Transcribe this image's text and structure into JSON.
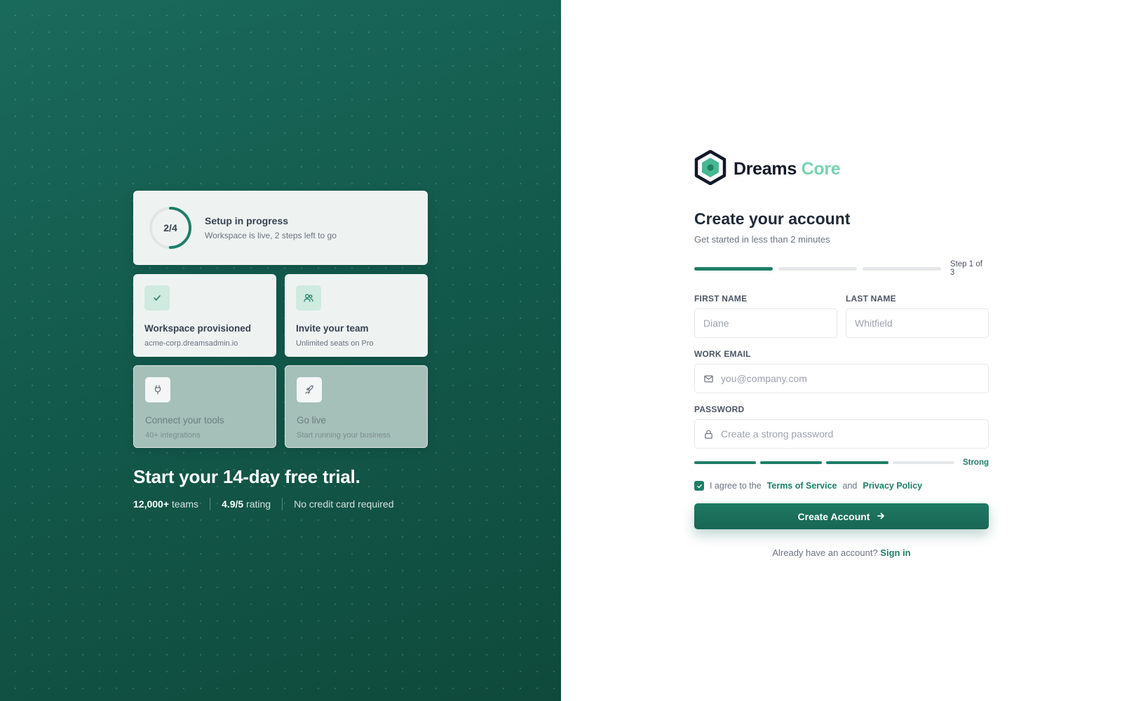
{
  "left": {
    "progress": {
      "fraction": "2/4",
      "value": 0.5,
      "title": "Setup in progress",
      "subtitle": "Workspace is live, 2 steps left to go"
    },
    "steps": [
      {
        "title": "Workspace provisioned",
        "subtitle": "acme-corp.dreamsadmin.io",
        "icon": "check-icon",
        "state": "done"
      },
      {
        "title": "Invite your team",
        "subtitle": "Unlimited seats on Pro",
        "icon": "users-icon",
        "state": "current"
      },
      {
        "title": "Connect your tools",
        "subtitle": "40+ integrations",
        "icon": "plug-icon",
        "state": "pending"
      },
      {
        "title": "Go live",
        "subtitle": "Start running your business",
        "icon": "rocket-icon",
        "state": "pending"
      }
    ],
    "headline": "Start your 14-day free trial.",
    "stats": {
      "teams_value": "12,000+",
      "teams_label": "teams",
      "rating_value": "4.9/5",
      "rating_label": "rating",
      "note": "No credit card required"
    }
  },
  "brand": {
    "name": "Dreams",
    "accent": "Core",
    "accent_color": "#7ad2b1",
    "logo_icon": "hexagon-logo-icon"
  },
  "form": {
    "title": "Create your account",
    "subtitle": "Get started in less than 2 minutes",
    "step": {
      "current": 1,
      "total": 3,
      "label": "Step 1 of 3"
    },
    "first_name": {
      "label": "FIRST NAME",
      "placeholder": "Diane"
    },
    "last_name": {
      "label": "LAST NAME",
      "placeholder": "Whitfield"
    },
    "email": {
      "label": "WORK EMAIL",
      "placeholder": "you@company.com",
      "icon": "mail-icon"
    },
    "password": {
      "label": "PASSWORD",
      "placeholder": "Create a strong password",
      "icon": "lock-icon"
    },
    "strength": {
      "level": 3,
      "max": 4,
      "label": "Strong"
    },
    "agree": {
      "checked": true,
      "prefix": "I agree to the",
      "terms": "Terms of Service",
      "and": "and",
      "privacy": "Privacy Policy"
    },
    "submit": "Create Account",
    "signin_prompt": "Already have an account?",
    "signin_link": "Sign in"
  },
  "colors": {
    "primary": "#1e7f68",
    "panel_dark": "#135a4c"
  }
}
